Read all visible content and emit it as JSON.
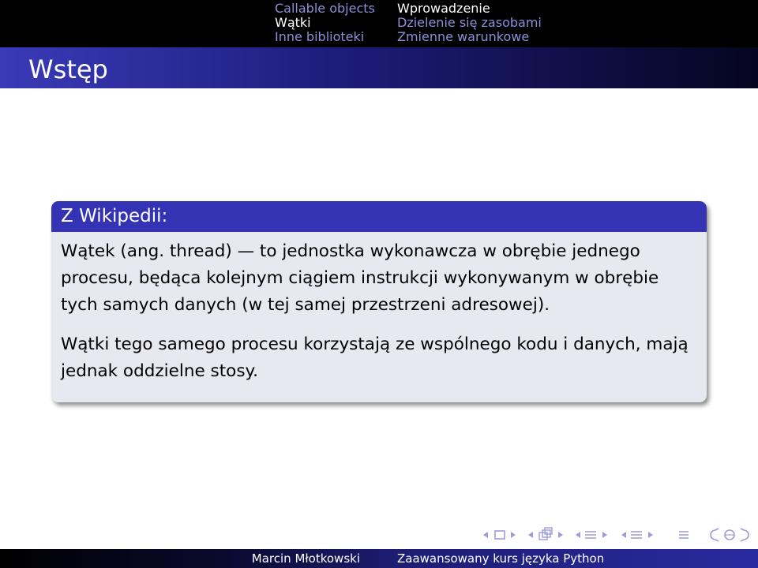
{
  "header": {
    "sections": [
      {
        "label": "Callable objects",
        "active": false
      },
      {
        "label": "Wątki",
        "active": true
      },
      {
        "label": "Inne biblioteki",
        "active": false
      }
    ],
    "subsections": [
      {
        "label": "Wprowadzenie",
        "active": true
      },
      {
        "label": "Dzielenie się zasobami",
        "active": false
      },
      {
        "label": "Zmienne warunkowe",
        "active": false
      }
    ]
  },
  "frame": {
    "title": "Wstęp"
  },
  "block": {
    "title": "Z Wikipedii:",
    "paragraph1": "Wątek (ang. thread) — to jednostka wykonawcza w obrębie jednego procesu, będąca kolejnym ciągiem instrukcji wykonywanym w obrębie tych samych danych (w tej samej przestrzeni adresowej).",
    "paragraph2": "Wątki tego samego procesu korzystają ze wspólnego kodu i danych, mają jednak oddzielne stosy."
  },
  "navigation_icons": [
    "prev-slide-icon",
    "slide-icon",
    "next-slide-icon",
    "prev-frame-icon",
    "frame-icon",
    "next-frame-icon",
    "prev-subsection-icon",
    "subsection-icon",
    "next-subsection-icon",
    "prev-section-icon",
    "section-icon",
    "next-section-icon",
    "toc-icon",
    "search-icon"
  ],
  "footer": {
    "author": "Marcin Młotkowski",
    "title": "Zaawansowany kurs języka Python"
  },
  "colors": {
    "block_header": "#3333b3",
    "block_body": "#e8e8f1",
    "nav_inactive": "#8f8fd8"
  }
}
